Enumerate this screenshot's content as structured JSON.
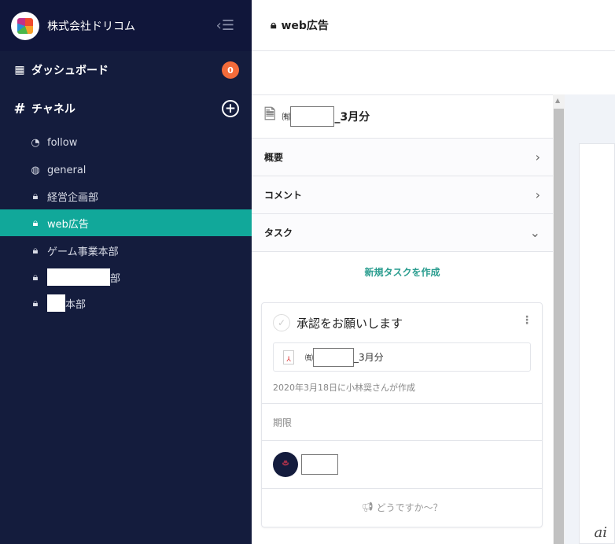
{
  "sidebar": {
    "org_name": "株式会社ドリコム",
    "dashboard": "ダッシュボード",
    "dashboard_badge": "0",
    "channels": "チャネル",
    "items": [
      {
        "label": "follow",
        "icon": "rss-icon"
      },
      {
        "label": "general",
        "icon": "globe-icon"
      },
      {
        "label": "経営企画部",
        "icon": "lock-icon"
      },
      {
        "label": "web広告",
        "icon": "lock-icon",
        "active": true
      },
      {
        "label": "ゲーム事業本部",
        "icon": "lock-icon"
      },
      {
        "label": "部",
        "icon": "lock-icon"
      },
      {
        "label": "本部",
        "icon": "lock-icon"
      }
    ]
  },
  "header": {
    "title": "web広告"
  },
  "document": {
    "prefix": "㈲",
    "suffix": "_3月分"
  },
  "sections": {
    "overview": "概要",
    "comments": "コメント",
    "tasks": "タスク"
  },
  "new_task": "新規タスクを作成",
  "task": {
    "title": "承認をお願いします",
    "attachment_prefix": "㈲",
    "attachment_suffix": "_3月分",
    "meta": "2020年3月18日に小林奨さんが作成",
    "due_label": "期限",
    "prompt": "どうですか～？"
  },
  "watermark": "ai"
}
